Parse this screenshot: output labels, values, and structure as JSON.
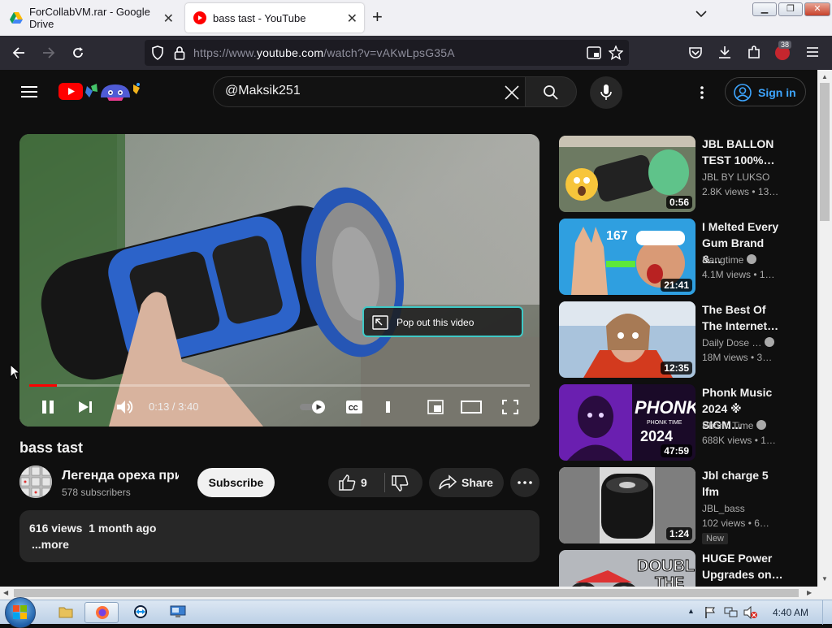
{
  "browser": {
    "tabs": [
      {
        "title": "ForCollabVM.rar - Google Drive",
        "icon": "google-drive-icon",
        "active": false
      },
      {
        "title": "bass tast - YouTube",
        "icon": "youtube-icon",
        "active": true
      }
    ],
    "url_prefix": "https://www.",
    "url_domain": "youtube.com",
    "url_path": "/watch?v=vAKwLpsG35A",
    "extension_badge": "38"
  },
  "youtube": {
    "search_value": "@Maksik251",
    "signin_label": "Sign in",
    "player": {
      "time": "0:13 / 3:40",
      "progress": 0.055,
      "popout_label": "Pop out this video"
    },
    "video": {
      "title": "bass tast",
      "channel_name": "Легенда ореха при",
      "subscribers": "578 subscribers",
      "subscribe_label": "Subscribe",
      "likes": "9",
      "share_label": "Share",
      "views": "616 views",
      "age": "1 month ago",
      "more_label": "...more"
    },
    "recommendations": [
      {
        "title": "JBL BALLON\nTEST 100%…",
        "channel": "JBL BY LUKSO",
        "verified": false,
        "stats": "2.8K views  •  13…",
        "duration": "0:56"
      },
      {
        "title": "I Melted Every\nGum Brand &…",
        "channel": "Hangtime",
        "verified": true,
        "stats": "4.1M views  •  1…",
        "duration": "21:41"
      },
      {
        "title": "The Best Of\nThe Internet…",
        "channel": "Daily Dose …",
        "verified": true,
        "stats": "18M views  •  3…",
        "duration": "12:35"
      },
      {
        "title": "Phonk Music\n2024 ※ SIGM…",
        "channel": "Phonk Time",
        "verified": true,
        "stats": "688K views  •  1…",
        "duration": "47:59"
      },
      {
        "title": "Jbl charge 5\nlfm",
        "channel": "JBL_bass",
        "verified": false,
        "stats": "102 views  •  6…",
        "duration": "1:24",
        "badge": "New"
      },
      {
        "title": "HUGE Power\nUpgrades on…",
        "channel": "",
        "verified": false,
        "stats": "",
        "duration": ""
      }
    ],
    "thumb_text": {
      "gum_count": "167",
      "phonk_big": "PHONK",
      "phonk_small": "PHONK TIME",
      "phonk_year": "2024",
      "double": "DOUBLE",
      "double2": "THE"
    }
  },
  "taskbar": {
    "clock": "4:40 AM"
  },
  "colors": {
    "youtube_red": "#ff0000",
    "link_blue": "#3ea6ff",
    "page_bg": "#0f0f0f"
  }
}
